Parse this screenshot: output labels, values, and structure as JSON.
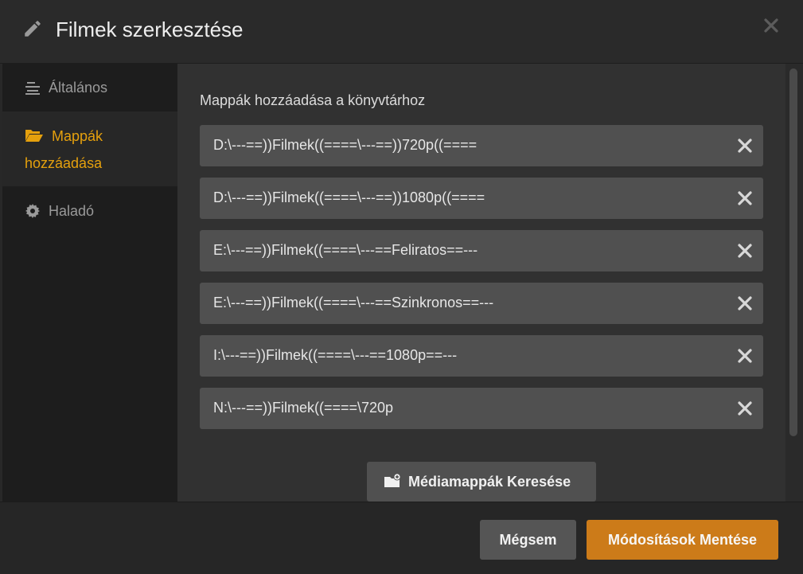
{
  "header": {
    "title": "Filmek szerkesztése",
    "icon": "pencil-icon",
    "close_icon": "close-icon"
  },
  "sidebar": {
    "items": [
      {
        "label": "Általános",
        "icon": "align-lines-icon",
        "active": false
      },
      {
        "label": "Mappák hozzáadása",
        "icon": "folder-open-icon",
        "active": true
      },
      {
        "label": "Haladó",
        "icon": "gear-icon",
        "active": false
      }
    ]
  },
  "content": {
    "section_title": "Mappák hozzáadása a könyvtárhoz",
    "folders": [
      "D:\\---==))Filmek((====\\---==))720p((====",
      "D:\\---==))Filmek((====\\---==))1080p((====",
      "E:\\---==))Filmek((====\\---==Feliratos==---",
      "E:\\---==))Filmek((====\\---==Szinkronos==---",
      "I:\\---==))Filmek((====\\---==1080p==---",
      "N:\\---==))Filmek((====\\720p"
    ],
    "browse_button": "Médiamappák Keresése"
  },
  "footer": {
    "cancel_label": "Mégsem",
    "save_label": "Módosítások Mentése"
  },
  "colors": {
    "accent": "#e5a00d",
    "save_button": "#cc7b19",
    "row_bg": "#505050"
  }
}
